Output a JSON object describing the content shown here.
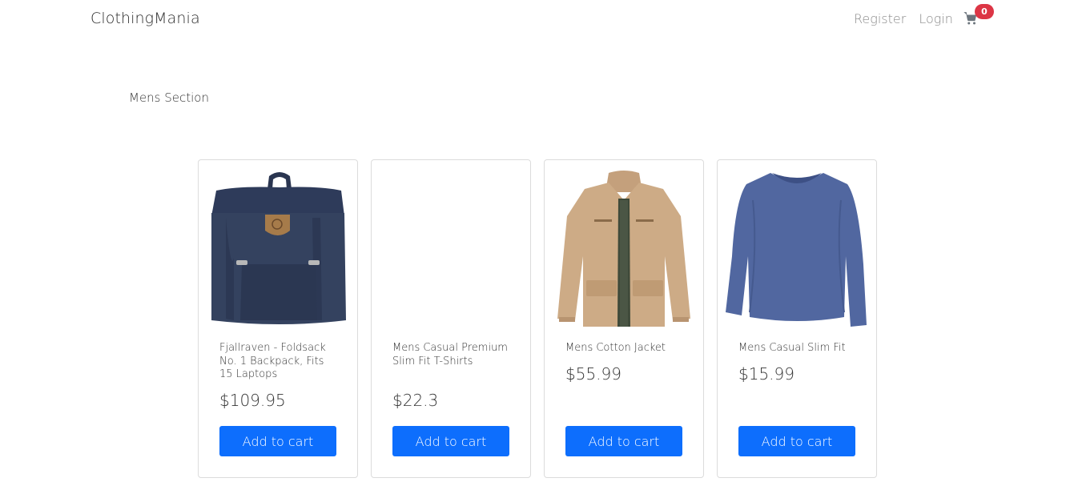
{
  "navbar": {
    "brand": "ClothingMania",
    "links": [
      "Register",
      "Login"
    ],
    "cart_count": "0",
    "cart_icon": "shopping-cart-icon"
  },
  "section": {
    "title": "Mens Section"
  },
  "products": [
    {
      "title": "Fjallraven - Foldsack No. 1 Backpack, Fits 15 Laptops",
      "price": "$109.95",
      "button": "Add to cart",
      "image": "navy-backpack"
    },
    {
      "title": "Mens Casual Premium Slim Fit T-Shirts",
      "price": "$22.3",
      "button": "Add to cart",
      "image": "blank"
    },
    {
      "title": "Mens Cotton Jacket",
      "price": "$55.99",
      "button": "Add to cart",
      "image": "khaki-jacket"
    },
    {
      "title": "Mens Casual Slim Fit",
      "price": "$15.99",
      "button": "Add to cart",
      "image": "blue-long-sleeve-shirt"
    }
  ],
  "colors": {
    "primary_button": "#0d6efd",
    "badge": "#dc3545",
    "navy": "#2f3d5c",
    "khaki": "#c9a886",
    "shirt_blue": "#4f6599"
  }
}
